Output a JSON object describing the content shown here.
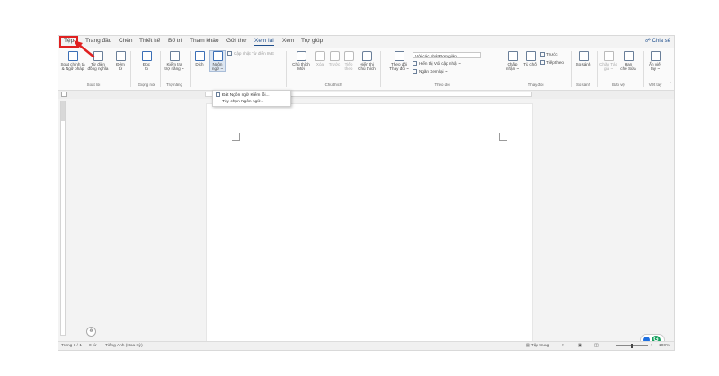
{
  "tabs": [
    "Tệp",
    "Trang đầu",
    "Chèn",
    "Thiết kế",
    "Bố trí",
    "Tham khảo",
    "Gửi thư",
    "Xem lại",
    "Xem",
    "Trợ giúp"
  ],
  "active_tab": "Xem lại",
  "share": "Chia sẻ",
  "ribbon": {
    "spelling": [
      "Soát chính tả",
      "& Ngữ pháp"
    ],
    "thesaurus": [
      "Từ điển",
      "đồng nghĩa"
    ],
    "word_count": [
      "Đếm",
      "từ"
    ],
    "read_aloud": [
      "Đọc",
      "to"
    ],
    "check_accessibility": [
      "Kiểm tra",
      "trợ năng ~"
    ],
    "translate": "Dịch",
    "language": [
      "Ngôn",
      "ngữ ~"
    ],
    "update_input": "Cập nhật Từ điển IME",
    "new_comment": [
      "Chú thích",
      "Mới"
    ],
    "delete": "Xóa",
    "previous": "Trước",
    "next": [
      "Tiếp",
      "theo"
    ],
    "show_comments": [
      "Hiển thị",
      "Chú thích"
    ],
    "track_changes": [
      "Theo dõi",
      "Thay đổi ~"
    ],
    "markup_dd": "Với các phát Đơn giản",
    "show_markup": "Hiển thị Với cập nhật ~",
    "reviewing_pane": "Ngăn Xem lại  ~",
    "accept": [
      "Chấp",
      "nhận ~"
    ],
    "reject": "Từ chối",
    "prev_change": "Trước",
    "next_change": "Tiếp theo",
    "compare": "So sánh",
    "block_authors": [
      "Chặn Tác",
      "giả ~"
    ],
    "restrict_editing": [
      "Hạn",
      "chế Sửa"
    ],
    "hide_ink": [
      "Ẩn viết",
      "tay ~"
    ]
  },
  "groups": [
    "Soát lỗi",
    "Giọng nói",
    "Trợ năng",
    "Chú thích",
    "Theo dõi",
    "Thay đổi",
    "So sánh",
    "Bảo vệ",
    "Viết tay"
  ],
  "language_menu": [
    "Đặt Ngôn ngữ Kiểm lỗi...",
    "Tùy chọn Ngôn ngữ..."
  ],
  "status": {
    "page": "Trang 1 / 1",
    "words": "0 từ",
    "language": "Tiếng Anh (Hoa Kỳ)",
    "focus": "Tập trung",
    "zoom": "100%"
  },
  "colors": {
    "accent": "#1e4e8c",
    "highlight": "#e02020",
    "grammarly": "#15a05e"
  }
}
